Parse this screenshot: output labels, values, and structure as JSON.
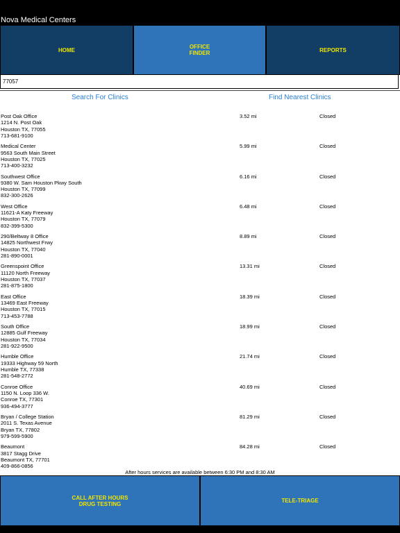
{
  "app": {
    "title": "Nova Medical Centers"
  },
  "nav": {
    "home": "HOME",
    "office_finder": "OFFICE\nFINDER",
    "reports": "REPORTS"
  },
  "search": {
    "value": "77057"
  },
  "actions": {
    "search_clinics": "Search For Clinics",
    "find_nearest": "Find Nearest Clinics"
  },
  "clinics": [
    {
      "name": "Post Oak Office",
      "address": "1214 N. Post Oak",
      "city": "Houston TX, 77055",
      "phone": "713-681-9100",
      "distance": "3.52 mi",
      "status": "Closed"
    },
    {
      "name": "Medical Center",
      "address": "9563 South Main Street",
      "city": "Houston TX, 77025",
      "phone": "713-400-3232",
      "distance": "5.99 mi",
      "status": "Closed"
    },
    {
      "name": "Southwest Office",
      "address": "9380 W. Sam Houston Pkwy South",
      "city": "Houston TX, 77099",
      "phone": "832-300-2626",
      "distance": "6.16 mi",
      "status": "Closed"
    },
    {
      "name": "West Office",
      "address": "11621-A Katy Freeway",
      "city": "Houston TX, 77079",
      "phone": "832-399-5300",
      "distance": "6.48 mi",
      "status": "Closed"
    },
    {
      "name": "290/Beltway 8 Office",
      "address": "14825 Northwest Frwy",
      "city": "Houston TX, 77040",
      "phone": "281-890-0001",
      "distance": "8.89 mi",
      "status": "Closed"
    },
    {
      "name": "Greenspoint Office",
      "address": "11120 North Freeway",
      "city": "Houston TX, 77037",
      "phone": "281-875-1800",
      "distance": "13.31 mi",
      "status": "Closed"
    },
    {
      "name": "East Office",
      "address": "13469 East Freeway",
      "city": "Houston TX, 77015",
      "phone": "713-453-7788",
      "distance": "18.39 mi",
      "status": "Closed"
    },
    {
      "name": "South Office",
      "address": "12885 Gulf Freeway",
      "city": "Houston TX, 77034",
      "phone": "281-922-9500",
      "distance": "18.99 mi",
      "status": "Closed"
    },
    {
      "name": "Humble Office",
      "address": "19333 Highway 59 North",
      "city": "Humble TX, 77338",
      "phone": "281-548-2772",
      "distance": "21.74 mi",
      "status": "Closed"
    },
    {
      "name": "Conroe Office",
      "address": "1150 N. Loop 336 W.",
      "city": "Conroe TX, 77301",
      "phone": "936-494-3777",
      "distance": "40.69 mi",
      "status": "Closed"
    },
    {
      "name": "Bryan / College Station",
      "address": "2011 S. Texas Avenue",
      "city": "Bryan TX, 77802",
      "phone": "979-599-5900",
      "distance": "81.29 mi",
      "status": "Closed"
    },
    {
      "name": "Beaumont",
      "address": "3817 Stagg Drive",
      "city": "Beaumont TX, 77701",
      "phone": "409-866-0856",
      "distance": "84.28 mi",
      "status": "Closed"
    }
  ],
  "footer": {
    "note": "After hours services are available between 6:30 PM and 8:30 AM",
    "call_after_hours": "CALL AFTER HOURS\nDRUG TESTING",
    "tele_triage": "TELE-TRIAGE"
  },
  "colors": {
    "nav_dark": "#123e66",
    "nav_active": "#2f73b8",
    "label_yellow": "#f2e600",
    "link_blue": "#2a7fd4"
  }
}
